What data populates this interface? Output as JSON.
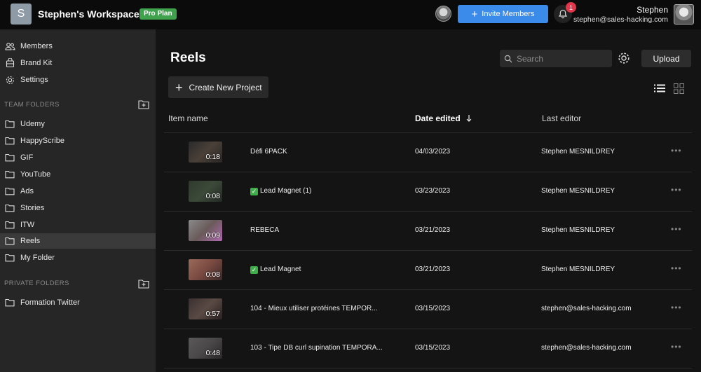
{
  "topbar": {
    "workspace_initial": "S",
    "workspace_name": "Stephen's Workspace",
    "plan_badge": "Pro Plan",
    "invite_label": "Invite Members",
    "notification_count": "1",
    "user_name": "Stephen",
    "user_email": "stephen@sales-hacking.com"
  },
  "sidebar": {
    "nav": [
      {
        "label": "Members",
        "icon": "members-icon"
      },
      {
        "label": "Brand Kit",
        "icon": "brand-kit-icon"
      },
      {
        "label": "Settings",
        "icon": "gear-icon"
      }
    ],
    "team_folders_label": "TEAM FOLDERS",
    "team_folders": [
      "Udemy",
      "HappyScribe",
      "GIF",
      "YouTube",
      "Ads",
      "Stories",
      "ITW",
      "Reels",
      "My Folder"
    ],
    "active_folder": "Reels",
    "private_folders_label": "PRIVATE FOLDERS",
    "private_folders": [
      "Formation Twitter"
    ]
  },
  "main": {
    "title": "Reels",
    "search_placeholder": "Search",
    "upload_label": "Upload",
    "create_label": "Create New Project",
    "columns": {
      "name": "Item name",
      "date": "Date edited",
      "editor": "Last editor"
    },
    "rows": [
      {
        "duration": "0:18",
        "name": "Défi 6PACK",
        "checked": false,
        "date": "04/03/2023",
        "editor": "Stephen MESNILDREY",
        "thumb_color": "#4a4038"
      },
      {
        "duration": "0:08",
        "name": "Lead Magnet (1)",
        "checked": true,
        "date": "03/23/2023",
        "editor": "Stephen MESNILDREY",
        "thumb_color": "#3c4a3a"
      },
      {
        "duration": "0:09",
        "name": "REBECA",
        "checked": false,
        "date": "03/21/2023",
        "editor": "Stephen MESNILDREY",
        "thumb_color": "#6a5a5a"
      },
      {
        "duration": "0:08",
        "name": "Lead Magnet",
        "checked": true,
        "date": "03/21/2023",
        "editor": "Stephen MESNILDREY",
        "thumb_color": "#7a4a42"
      },
      {
        "duration": "0:57",
        "name": "104 - Mieux utiliser protéines TEMPOR...",
        "checked": false,
        "date": "03/15/2023",
        "editor": "stephen@sales-hacking.com",
        "thumb_color": "#5a4a44"
      },
      {
        "duration": "0:48",
        "name": "103 - Tipe DB curl supination TEMPORA...",
        "checked": false,
        "date": "03/15/2023",
        "editor": "stephen@sales-hacking.com",
        "thumb_color": "#4a4848"
      }
    ]
  },
  "colors": {
    "accent": "#3b8beb",
    "badge_green": "#3fa34d",
    "notification_red": "#e2364a"
  }
}
